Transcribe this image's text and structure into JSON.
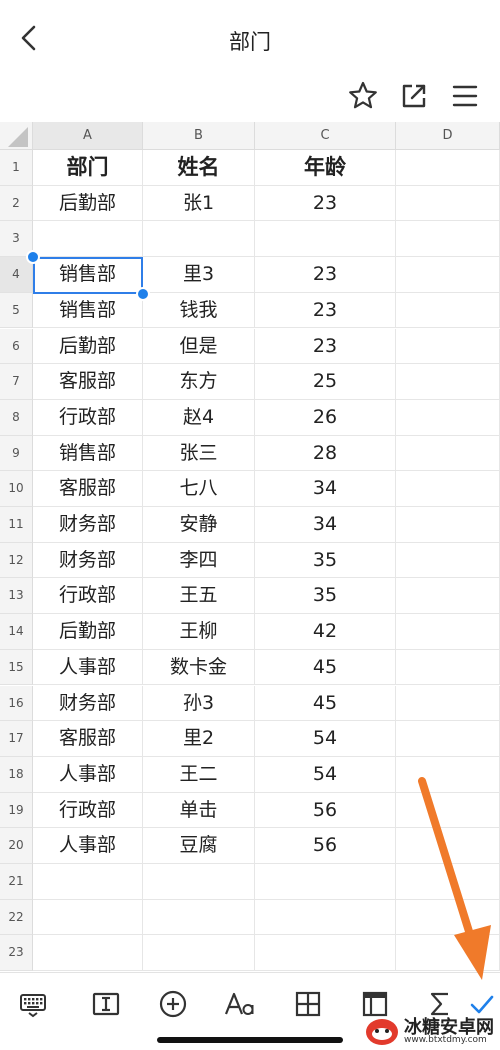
{
  "header": {
    "title": "部门",
    "back_icon": "chevron-left-icon"
  },
  "actions": [
    "star-icon",
    "share-icon",
    "menu-icon"
  ],
  "sheet": {
    "columns": [
      "A",
      "B",
      "C",
      "D"
    ],
    "active_column": "A",
    "rows": [
      {
        "n": "1",
        "cells": [
          "部门",
          "姓名",
          "年龄",
          ""
        ]
      },
      {
        "n": "2",
        "cells": [
          "后勤部",
          "张1",
          "23",
          ""
        ]
      },
      {
        "n": "3",
        "cells": [
          "",
          "",
          "",
          ""
        ]
      },
      {
        "n": "4",
        "cells": [
          "销售部",
          "里3",
          "23",
          ""
        ]
      },
      {
        "n": "5",
        "cells": [
          "销售部",
          "钱我",
          "23",
          ""
        ]
      },
      {
        "n": "6",
        "cells": [
          "后勤部",
          "但是",
          "23",
          ""
        ]
      },
      {
        "n": "7",
        "cells": [
          "客服部",
          "东方",
          "25",
          ""
        ]
      },
      {
        "n": "8",
        "cells": [
          "行政部",
          "赵4",
          "26",
          ""
        ]
      },
      {
        "n": "9",
        "cells": [
          "销售部",
          "张三",
          "28",
          ""
        ]
      },
      {
        "n": "10",
        "cells": [
          "客服部",
          "七八",
          "34",
          ""
        ]
      },
      {
        "n": "11",
        "cells": [
          "财务部",
          "安静",
          "34",
          ""
        ]
      },
      {
        "n": "12",
        "cells": [
          "财务部",
          "李四",
          "35",
          ""
        ]
      },
      {
        "n": "13",
        "cells": [
          "行政部",
          "王五",
          "35",
          ""
        ]
      },
      {
        "n": "14",
        "cells": [
          "后勤部",
          "王柳",
          "42",
          ""
        ]
      },
      {
        "n": "15",
        "cells": [
          "人事部",
          "数卡金",
          "45",
          ""
        ]
      },
      {
        "n": "16",
        "cells": [
          "财务部",
          "孙3",
          "45",
          ""
        ]
      },
      {
        "n": "17",
        "cells": [
          "客服部",
          "里2",
          "54",
          ""
        ]
      },
      {
        "n": "18",
        "cells": [
          "人事部",
          "王二",
          "54",
          ""
        ]
      },
      {
        "n": "19",
        "cells": [
          "行政部",
          "单击",
          "56",
          ""
        ]
      },
      {
        "n": "20",
        "cells": [
          "人事部",
          "豆腐",
          "56",
          ""
        ]
      },
      {
        "n": "21",
        "cells": [
          "",
          "",
          "",
          ""
        ]
      },
      {
        "n": "22",
        "cells": [
          "",
          "",
          "",
          ""
        ]
      },
      {
        "n": "23",
        "cells": [
          "",
          "",
          "",
          ""
        ]
      }
    ],
    "selected_row": "4",
    "selected_cell": "A4"
  },
  "toolbar": [
    "keyboard-icon",
    "text-cursor-icon",
    "add-circle-icon",
    "font-icon",
    "table-grid-icon",
    "freeze-panes-icon",
    "sigma-icon",
    "check-icon"
  ],
  "colors": {
    "selection": "#2f7ee8",
    "annotation_arrow": "#f07a2a",
    "header_bg": "#f4f4f4"
  },
  "watermark": {
    "name": "冰糖安卓网",
    "url": "www.btxtdmy.com"
  }
}
